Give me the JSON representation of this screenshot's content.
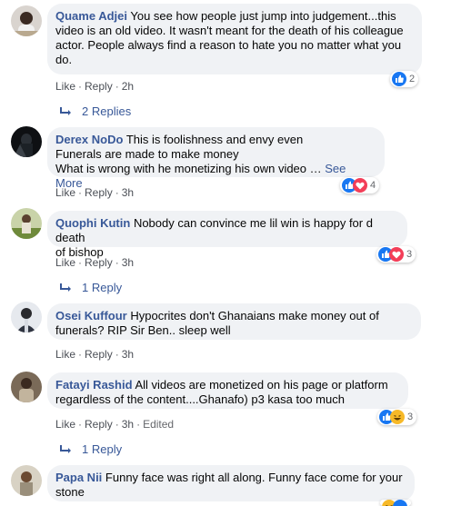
{
  "comments": [
    {
      "author": "Quame Adjei",
      "lines": [
        "You see how people just jump into judgement...this",
        "video is an old video. It wasn't meant for the death of his colleague",
        "actor. People always find a reason to hate you no matter what you",
        "do."
      ],
      "like": "Like",
      "reply": "Reply",
      "time": "2h",
      "reaction_count": "2",
      "replies_label": "2 Replies"
    },
    {
      "author": "Derex NoDo",
      "lines": [
        "This is foolishness and envy even",
        "Funerals are made to make money",
        "What is wrong with he monetizing his own video …"
      ],
      "see_more": "See More",
      "like": "Like",
      "reply": "Reply",
      "time": "3h",
      "reaction_count": "4"
    },
    {
      "author": "Quophi Kutin",
      "lines": [
        "Nobody can convince me lil win is happy for d death",
        "of bishop"
      ],
      "like": "Like",
      "reply": "Reply",
      "time": "3h",
      "reaction_count": "3",
      "replies_label": "1 Reply"
    },
    {
      "author": "Osei Kuffour",
      "lines": [
        "Hypocrites don't Ghanaians make money out of",
        "funerals? RIP Sir Ben.. sleep well"
      ],
      "like": "Like",
      "reply": "Reply",
      "time": "3h"
    },
    {
      "author": "Fatayi Rashid",
      "lines": [
        "All videos are monetized on his page or platform",
        "regardless of the content....Ghanafo) p3 kasa too much"
      ],
      "like": "Like",
      "reply": "Reply",
      "time": "3h",
      "edited": "Edited",
      "reaction_count": "3",
      "replies_label": "1 Reply"
    },
    {
      "author": "Papa Nii",
      "lines": [
        "Funny face was right all along. Funny face come for your",
        "stone"
      ]
    }
  ],
  "colors": {
    "author_link": "#385898",
    "bubble_bg": "#f0f2f5",
    "like_blue": "#1877f2",
    "love_red": "#f33e58",
    "haha_yellow": "#f7b928"
  },
  "icons": [
    "like-icon",
    "love-icon",
    "haha-icon",
    "reply-arrow-icon"
  ]
}
